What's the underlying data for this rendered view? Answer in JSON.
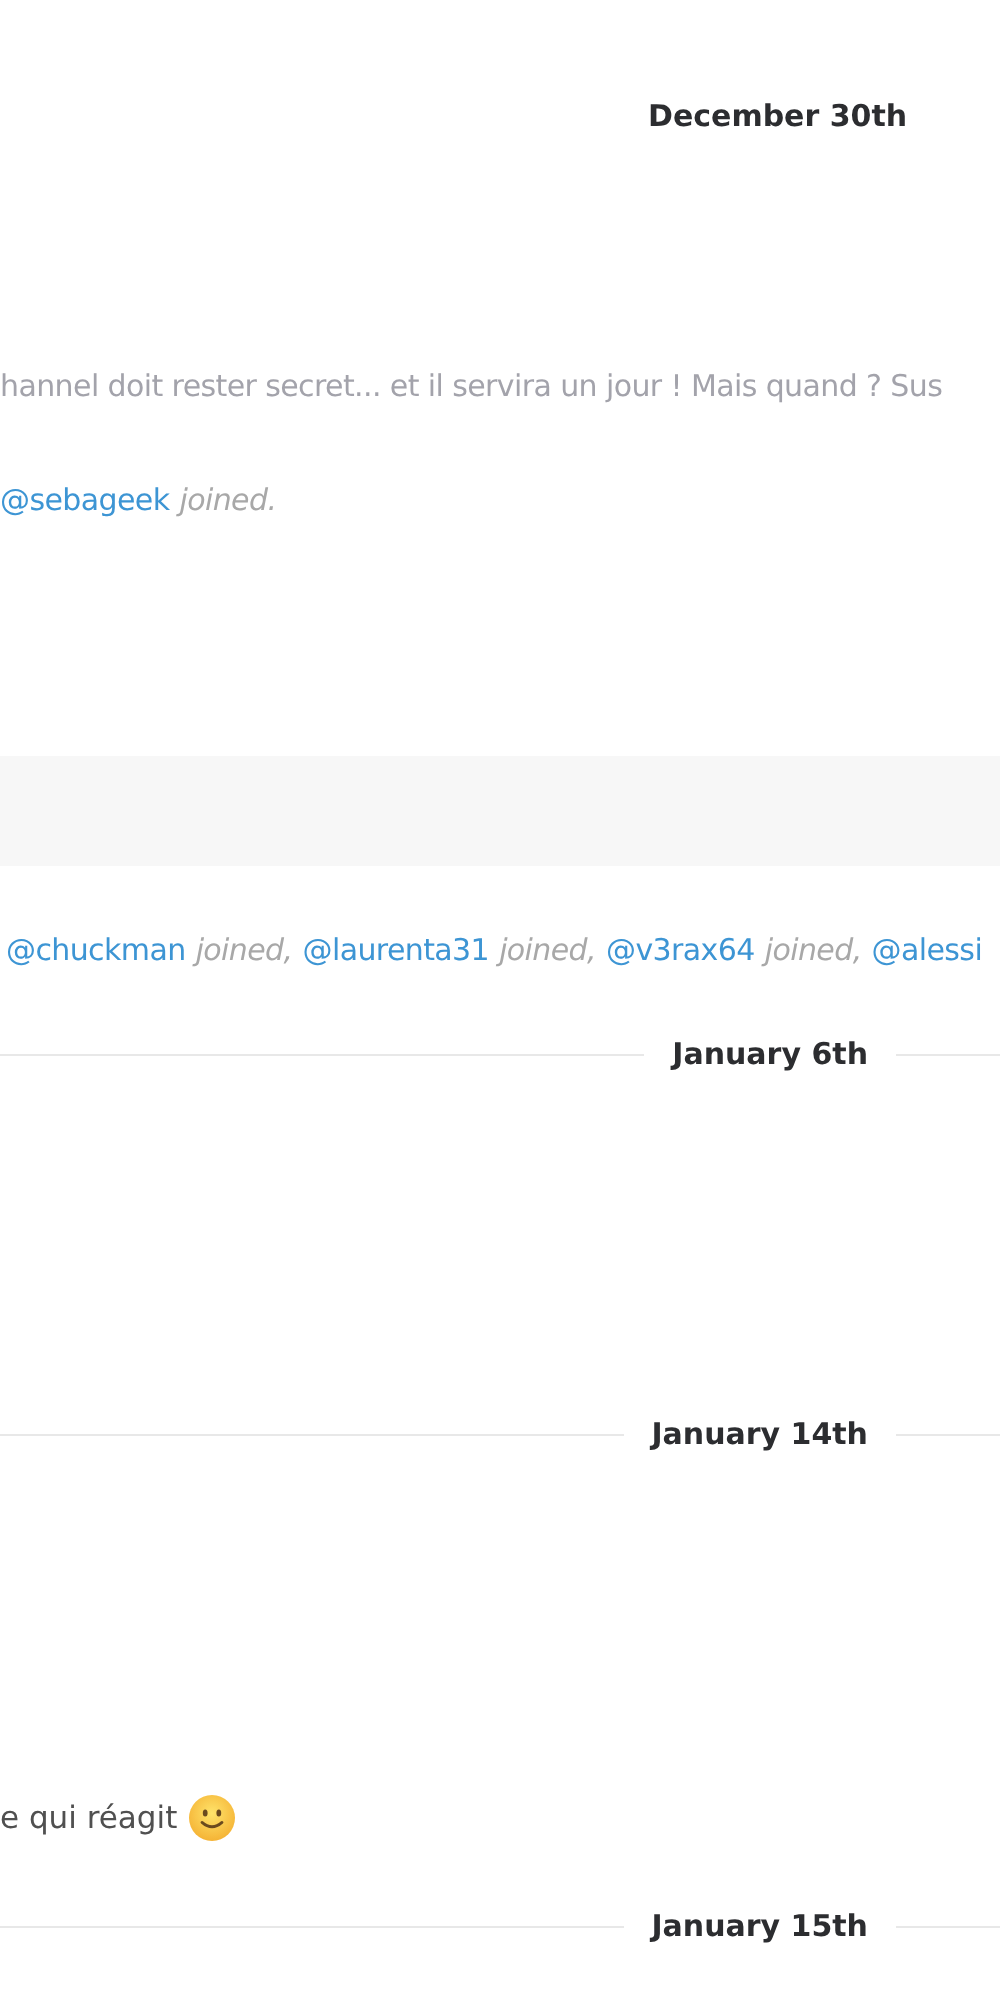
{
  "top_date": "December 30th",
  "first_message": {
    "text": "hannel doit rester secret... et il servira un jour ! Mais quand ? Sus"
  },
  "first_joins": [
    {
      "user": "@sebageek",
      "text": "joined."
    }
  ],
  "second_joins": [
    {
      "user": "@chuckman",
      "text": "joined,"
    },
    {
      "user": "@laurenta31",
      "text": "joined,"
    },
    {
      "user": "@v3rax64",
      "text": "joined,"
    },
    {
      "user": "@alessi"
    }
  ],
  "dividers": [
    "January 6th",
    "January 14th"
  ],
  "last_message": {
    "text": "e qui réagit"
  },
  "last_divider": "January 15th"
}
